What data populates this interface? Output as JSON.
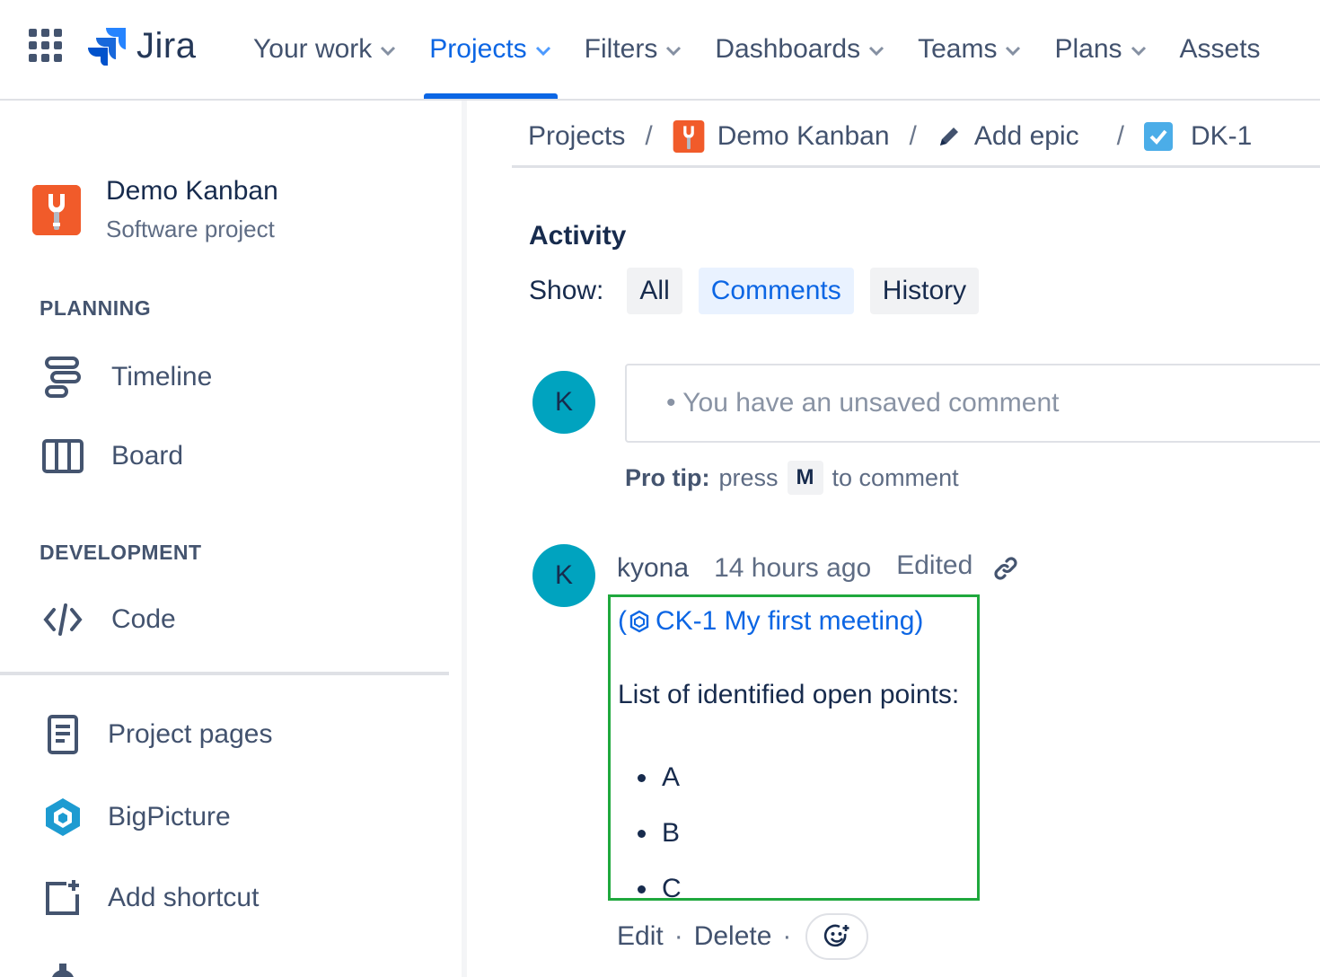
{
  "topnav": {
    "app_name": "Jira",
    "items": [
      {
        "label": "Your work",
        "has_dropdown": true,
        "active": false
      },
      {
        "label": "Projects",
        "has_dropdown": true,
        "active": true
      },
      {
        "label": "Filters",
        "has_dropdown": true,
        "active": false
      },
      {
        "label": "Dashboards",
        "has_dropdown": true,
        "active": false
      },
      {
        "label": "Teams",
        "has_dropdown": true,
        "active": false
      },
      {
        "label": "Plans",
        "has_dropdown": true,
        "active": false
      },
      {
        "label": "Assets",
        "has_dropdown": false,
        "active": false
      }
    ],
    "accent_color": "#0c66e4"
  },
  "sidebar": {
    "project": {
      "name": "Demo Kanban",
      "type": "Software project",
      "avatar_color": "#f15b2a"
    },
    "sections": [
      {
        "label": "PLANNING",
        "items": [
          {
            "label": "Timeline",
            "icon": "timeline-icon"
          },
          {
            "label": "Board",
            "icon": "board-icon"
          }
        ]
      },
      {
        "label": "DEVELOPMENT",
        "items": [
          {
            "label": "Code",
            "icon": "code-icon"
          }
        ]
      }
    ],
    "extra_items": [
      {
        "label": "Project pages",
        "icon": "page-icon"
      },
      {
        "label": "BigPicture",
        "icon": "bigpicture-icon"
      },
      {
        "label": "Add shortcut",
        "icon": "add-shortcut-icon"
      }
    ]
  },
  "breadcrumb": {
    "items": [
      {
        "label": "Projects",
        "icon": ""
      },
      {
        "label": "Demo Kanban",
        "icon": "project-avatar-icon"
      },
      {
        "label": "Add epic",
        "icon": "pencil-icon"
      },
      {
        "label": "DK-1",
        "icon": "task-checkbox-icon"
      }
    ],
    "separator": "/"
  },
  "activity": {
    "title": "Activity",
    "show_label": "Show:",
    "filters": [
      {
        "label": "All",
        "selected": false
      },
      {
        "label": "Comments",
        "selected": true
      },
      {
        "label": "History",
        "selected": false
      }
    ],
    "new_comment": {
      "avatar_initial": "K",
      "placeholder": "• You have an unsaved comment",
      "pro_tip_label": "Pro tip:",
      "pro_tip_press": "press",
      "pro_tip_key": "M",
      "pro_tip_suffix": "to comment"
    },
    "comment": {
      "avatar_initial": "K",
      "author": "kyona",
      "time": "14 hours ago",
      "edited": "Edited",
      "link_prefix": "(",
      "link_text": "CK-1 My first meeting)",
      "paragraph": "List of identified open points:",
      "list": [
        "A",
        "B",
        "C"
      ],
      "actions": {
        "edit": "Edit",
        "delete": "Delete",
        "separator": "·"
      },
      "highlight_color": "#1fa83d"
    }
  }
}
